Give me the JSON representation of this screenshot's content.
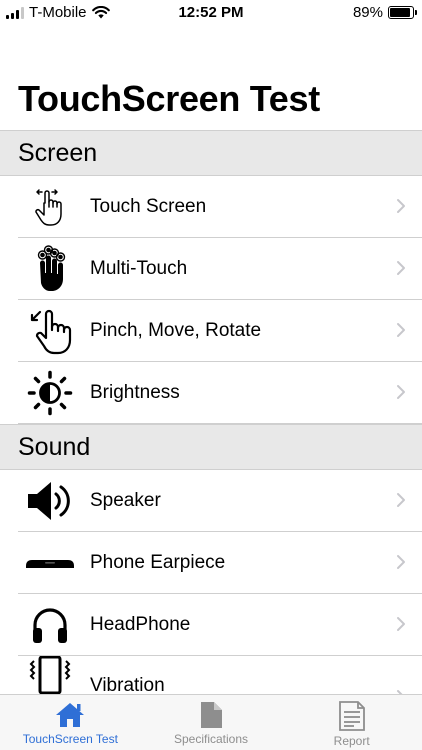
{
  "status_bar": {
    "carrier": "T-Mobile",
    "time": "12:52 PM",
    "battery_percent": "89%",
    "battery_level": 0.89
  },
  "title": "TouchScreen Test",
  "sections": [
    {
      "header": "Screen",
      "items": [
        {
          "label": "Touch Screen",
          "icon": "touch-screen-icon"
        },
        {
          "label": "Multi-Touch",
          "icon": "multi-touch-icon"
        },
        {
          "label": "Pinch, Move, Rotate",
          "icon": "pinch-icon"
        },
        {
          "label": "Brightness",
          "icon": "brightness-icon"
        }
      ]
    },
    {
      "header": "Sound",
      "items": [
        {
          "label": "Speaker",
          "icon": "speaker-icon"
        },
        {
          "label": "Phone Earpiece",
          "icon": "earpiece-icon"
        },
        {
          "label": "HeadPhone",
          "icon": "headphone-icon"
        },
        {
          "label": "Vibration",
          "icon": "vibration-icon"
        }
      ]
    }
  ],
  "tabs": [
    {
      "label": "TouchScreen Test",
      "icon": "home-icon",
      "active": true
    },
    {
      "label": "Specifications",
      "icon": "document-icon",
      "active": false
    },
    {
      "label": "Report",
      "icon": "report-icon",
      "active": false
    }
  ],
  "colors": {
    "accent": "#2f6fd6",
    "section_bg": "#e8e8e8",
    "separator": "#cfcfcf",
    "chevron": "#c7c7cc",
    "inactive_tab": "#8e8e8e"
  }
}
